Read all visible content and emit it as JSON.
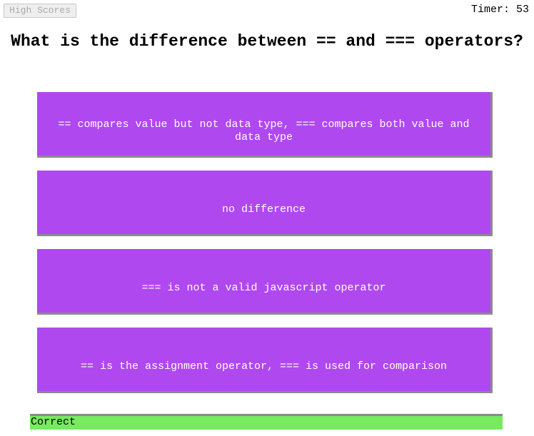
{
  "header": {
    "high_scores_label": "High Scores",
    "timer_text": "Timer: 53"
  },
  "quiz": {
    "question": "What is the difference between == and === operators?",
    "answers": [
      "== compares value but not data type, === compares both value and data type",
      "no difference",
      "=== is not a valid javascript operator",
      "== is the assignment operator, === is used for comparison"
    ]
  },
  "feedback": {
    "text": "Correct",
    "color": "#77ea60"
  },
  "colors": {
    "answer_background": "#b048ef",
    "answer_text": "#ffffff"
  }
}
